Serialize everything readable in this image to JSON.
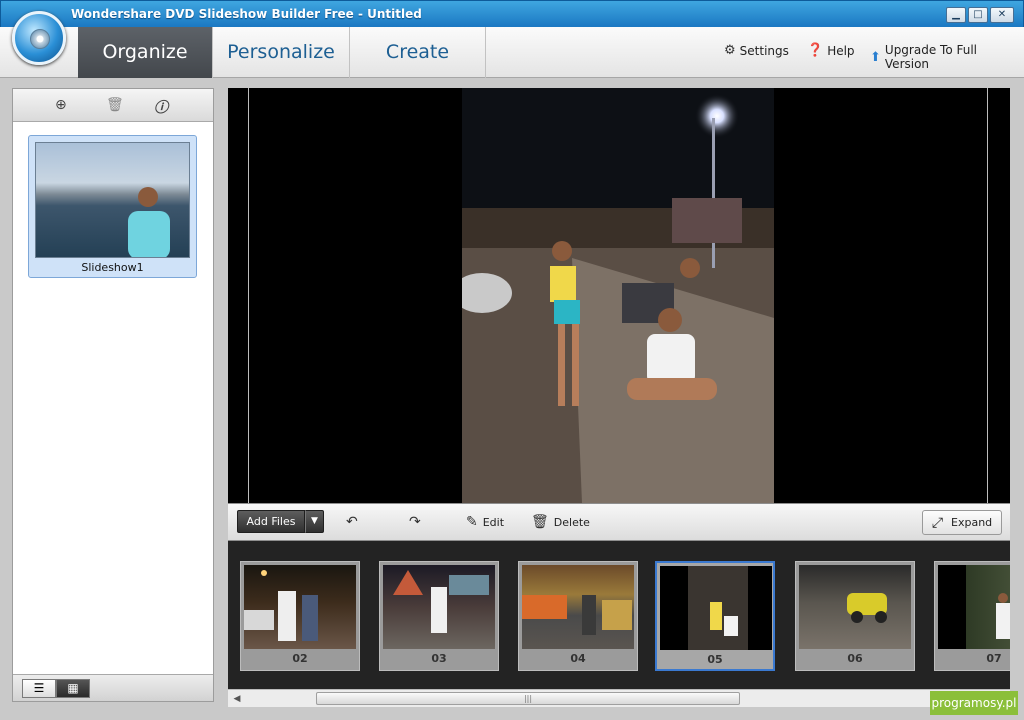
{
  "window": {
    "title": "Wondershare DVD Slideshow Builder Free - Untitled",
    "minimize": "▁",
    "maximize": "□",
    "close": "✕"
  },
  "tabs": {
    "organize": "Organize",
    "personalize": "Personalize",
    "create": "Create"
  },
  "top_links": {
    "settings": "Settings",
    "help": "Help",
    "upgrade": "Upgrade To Full Version"
  },
  "left_panel": {
    "slideshow_label": "Slideshow1"
  },
  "edit_bar": {
    "add_files": "Add Files",
    "edit": "Edit",
    "delete": "Delete",
    "expand": "Expand"
  },
  "filmstrip": {
    "items": [
      {
        "number": "02",
        "selected": false
      },
      {
        "number": "03",
        "selected": false
      },
      {
        "number": "04",
        "selected": false
      },
      {
        "number": "05",
        "selected": true
      },
      {
        "number": "06",
        "selected": false
      },
      {
        "number": "07",
        "selected": false
      }
    ]
  },
  "watermark": "programosy.pl",
  "colors": {
    "title_bar": "#2a8fd6",
    "active_tab": "#4c5157",
    "tab_text": "#1d5f93",
    "selection": "#3a79d0",
    "watermark": "#8bbf3a"
  }
}
